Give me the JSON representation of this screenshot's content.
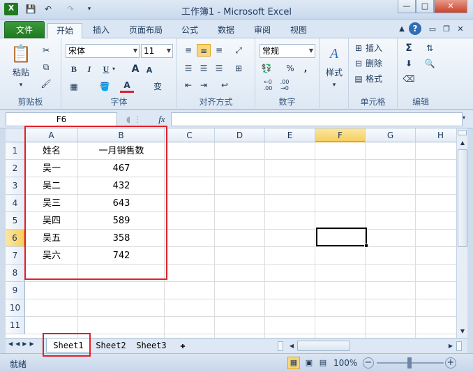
{
  "window": {
    "title": "工作簿1 - Microsoft Excel",
    "controls": {
      "minimize": "—",
      "maximize": "□",
      "close": "✕"
    }
  },
  "tabs": [
    {
      "label": "文件"
    },
    {
      "label": "开始"
    },
    {
      "label": "插入"
    },
    {
      "label": "页面布局"
    },
    {
      "label": "公式"
    },
    {
      "label": "数据"
    },
    {
      "label": "审阅"
    },
    {
      "label": "视图"
    }
  ],
  "ribbon": {
    "clipboard": {
      "paste": "粘贴",
      "label": "剪贴板"
    },
    "font": {
      "name": "宋体",
      "size": "11",
      "bold": "B",
      "italic": "I",
      "underline": "U",
      "grow": "A",
      "shrink": "A",
      "color_a": "A",
      "wen": "变",
      "label": "字体"
    },
    "alignment": {
      "label": "对齐方式"
    },
    "number": {
      "format": "常规",
      "percent": "%",
      "comma": ",",
      "label": "数字"
    },
    "styles": {
      "button": "样式"
    },
    "cells": {
      "insert": "插入",
      "delete": "删除",
      "format": "格式",
      "label": "单元格"
    },
    "editing": {
      "sum": "Σ",
      "label": "编辑"
    }
  },
  "formula_bar": {
    "name_box": "F6",
    "fx": "fx",
    "value": ""
  },
  "columns": [
    "A",
    "B",
    "C",
    "D",
    "E",
    "F",
    "G",
    "H"
  ],
  "selected_column": "F",
  "rows": [
    "1",
    "2",
    "3",
    "4",
    "5",
    "6",
    "7",
    "8",
    "9",
    "10",
    "11"
  ],
  "selected_row": "6",
  "cells": {
    "header": [
      "姓名",
      "一月销售数"
    ],
    "data": [
      [
        "吴一",
        "467"
      ],
      [
        "吴二",
        "432"
      ],
      [
        "吴三",
        "643"
      ],
      [
        "吴四",
        "589"
      ],
      [
        "吴五",
        "358"
      ],
      [
        "吴六",
        "742"
      ]
    ]
  },
  "sheets": [
    "Sheet1",
    "Sheet2",
    "Sheet3"
  ],
  "active_sheet": "Sheet1",
  "status": {
    "mode": "就绪",
    "zoom": "100%"
  },
  "colors": {
    "file_tab": "#2a8a2b",
    "selection_header": "#f6cf5e",
    "annotation": "#e0202a"
  }
}
